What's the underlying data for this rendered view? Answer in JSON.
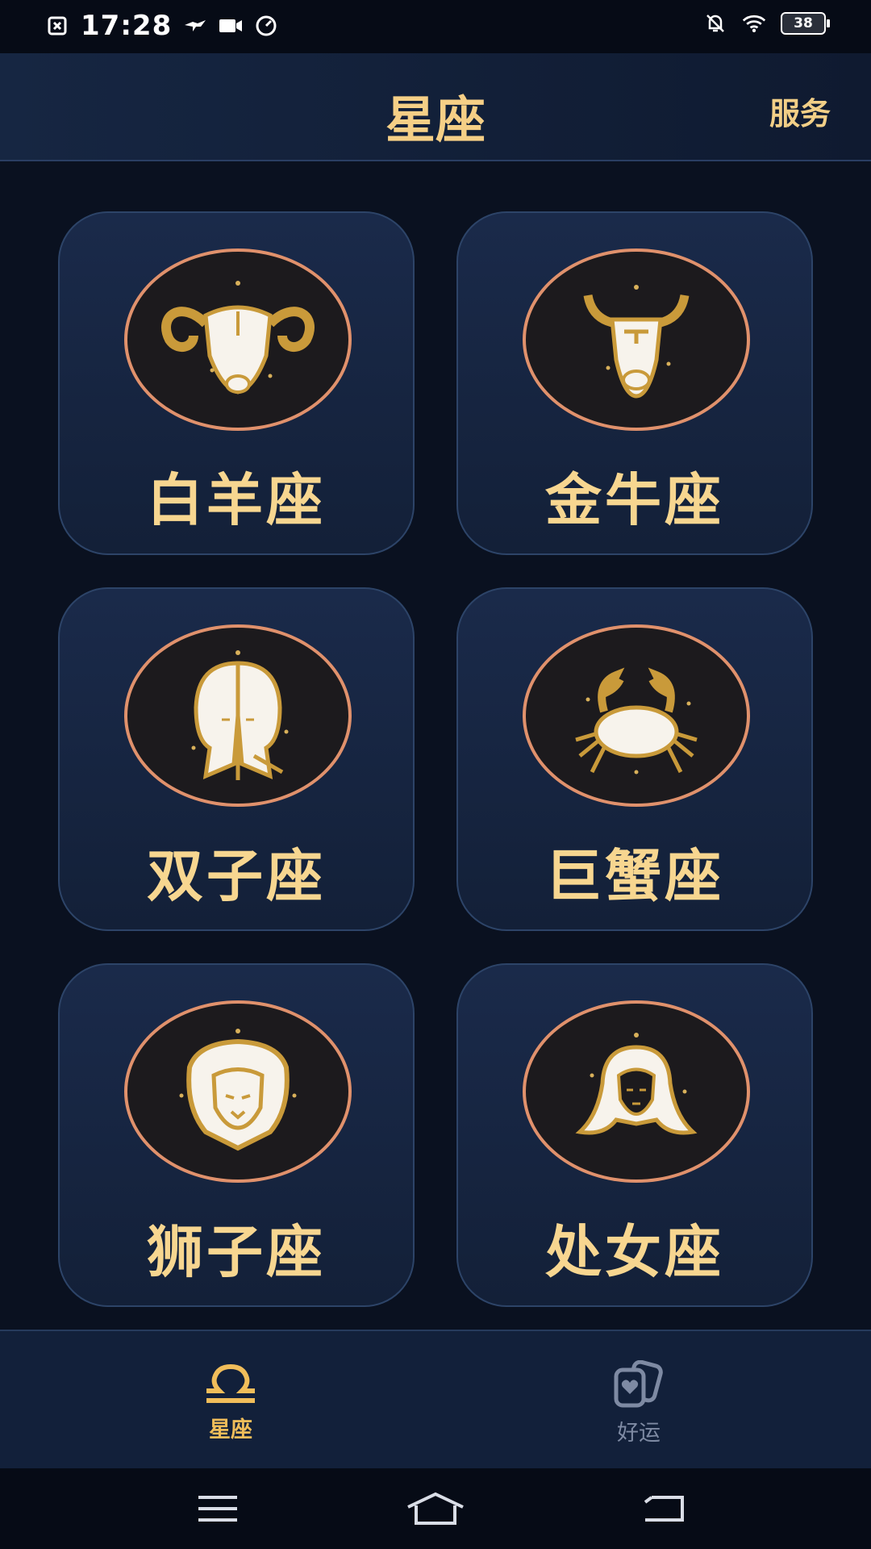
{
  "status_bar": {
    "time": "17:28",
    "battery": "38",
    "icons": [
      "close-box-icon",
      "bird-icon",
      "video-icon",
      "speedometer-icon",
      "bell-off-icon",
      "wifi-icon",
      "battery-icon"
    ]
  },
  "app_bar": {
    "title": "星座",
    "action_label": "服务"
  },
  "signs": [
    {
      "label": "白羊座",
      "icon": "aries-ram-icon"
    },
    {
      "label": "金牛座",
      "icon": "taurus-bull-icon"
    },
    {
      "label": "双子座",
      "icon": "gemini-twins-icon"
    },
    {
      "label": "巨蟹座",
      "icon": "cancer-crab-icon"
    },
    {
      "label": "狮子座",
      "icon": "leo-lion-icon"
    },
    {
      "label": "处女座",
      "icon": "virgo-maiden-icon"
    }
  ],
  "tab_bar": {
    "tabs": [
      {
        "label": "星座",
        "icon": "libra-icon",
        "active": true
      },
      {
        "label": "好运",
        "icon": "cards-heart-icon",
        "active": false
      }
    ]
  },
  "nav_bar": {
    "buttons": [
      "menu-icon",
      "home-icon",
      "back-icon"
    ]
  },
  "colors": {
    "accent_gold": "#f5cf86",
    "medallion_ring": "#e0916c",
    "card_bg": "#17264a",
    "background": "#0a1120",
    "inactive": "#7e8aa3"
  }
}
